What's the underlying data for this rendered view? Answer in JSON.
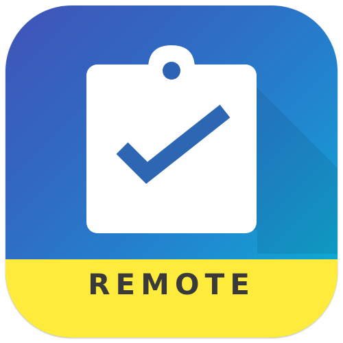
{
  "app_icon": {
    "label": "REMOTE",
    "icon": "clipboard-check-icon",
    "colors": {
      "gradient_start": "#4153b7",
      "gradient_end": "#07b7d3",
      "label_band": "#ffeb3b",
      "label_text": "#3a3a3a",
      "clipboard": "#ffffff",
      "check": "#2d66b3"
    }
  }
}
